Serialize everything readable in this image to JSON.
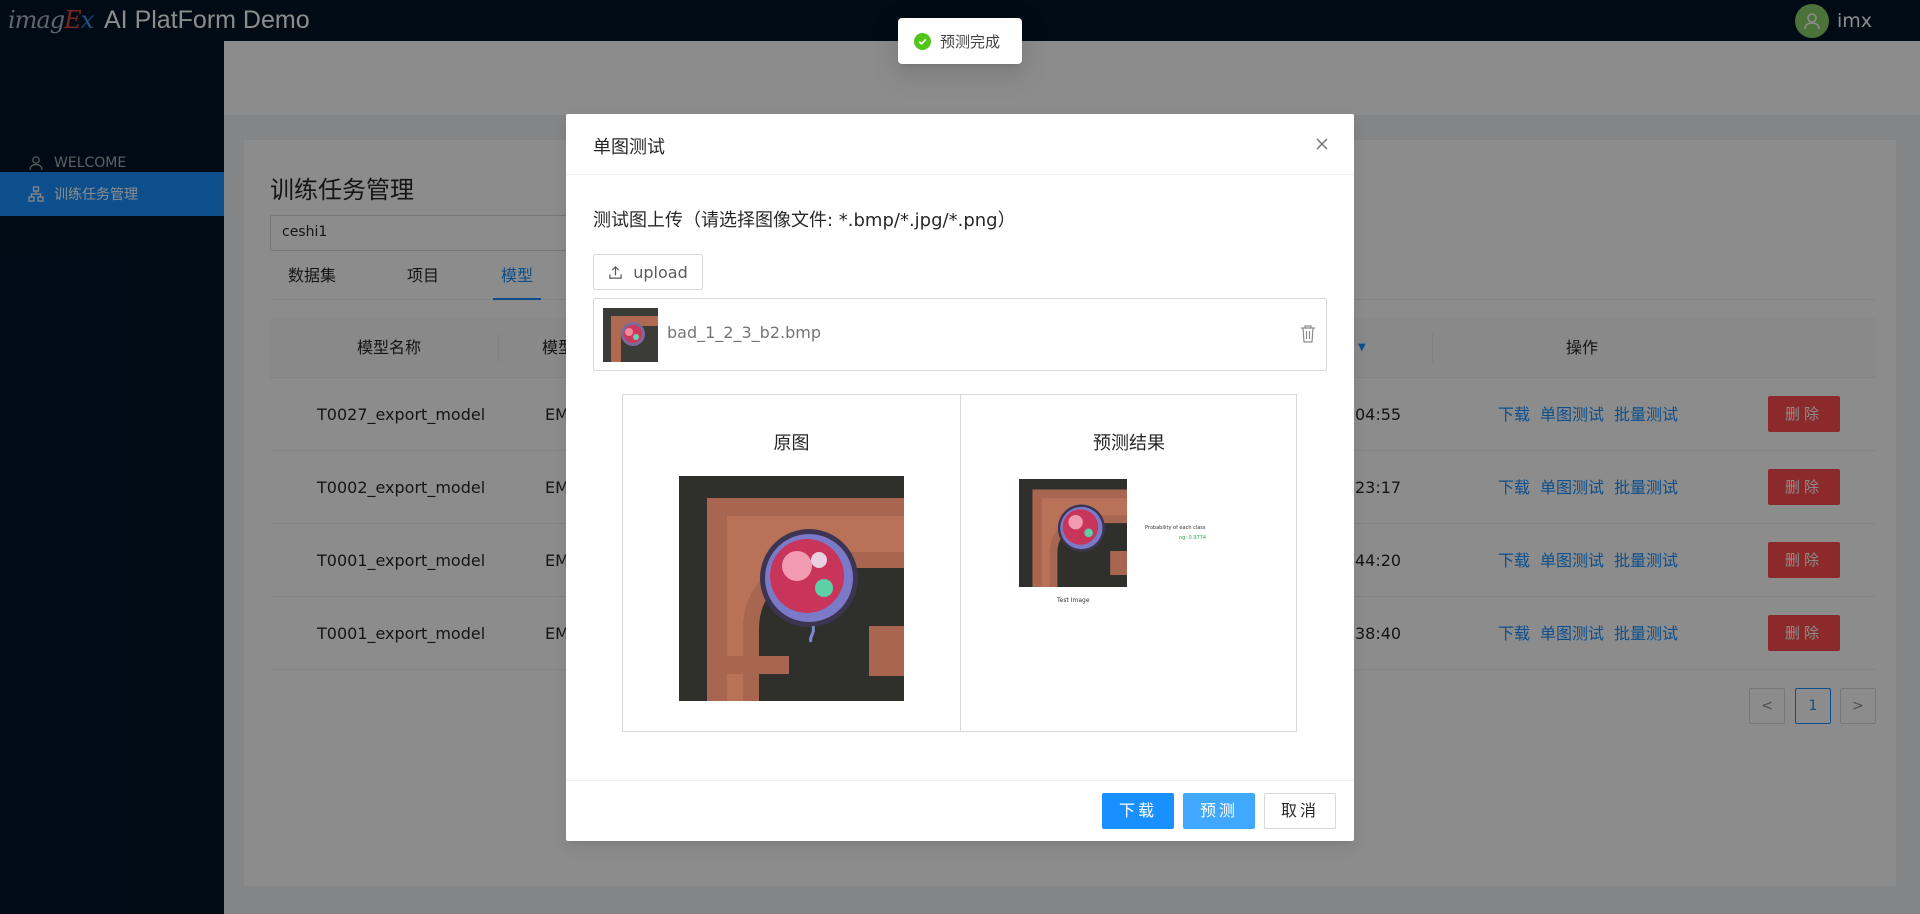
{
  "app": {
    "logo_text": "imagex",
    "title": "AI PlatForm Demo"
  },
  "user": {
    "name": "imx"
  },
  "sidebar": {
    "items": [
      {
        "label": "WELCOME",
        "icon": "user-icon"
      },
      {
        "label": "训练任务管理",
        "icon": "cluster-icon",
        "active": true
      }
    ]
  },
  "page": {
    "title": "训练任务管理",
    "search_value": "ceshi1",
    "tabs": [
      {
        "label": "数据集"
      },
      {
        "label": "项目"
      },
      {
        "label": "模型",
        "active": true
      }
    ]
  },
  "table": {
    "headers": {
      "name": "模型名称",
      "type": "模型",
      "actions": "操作"
    },
    "rows": [
      {
        "name": "T0027_export_model",
        "type": "EM",
        "time": "04:55"
      },
      {
        "name": "T0002_export_model",
        "type": "EM",
        "time": "23:17"
      },
      {
        "name": "T0001_export_model",
        "type": "EM",
        "time": "44:20"
      },
      {
        "name": "T0001_export_model",
        "type": "EM",
        "time": "38:40"
      }
    ],
    "action_labels": {
      "download": "下载",
      "single_test": "单图测试",
      "batch_test": "批量测试",
      "delete": "删除"
    }
  },
  "pagination": {
    "prev": "<",
    "current": "1",
    "next": ">"
  },
  "modal": {
    "title": "单图测试",
    "upload_label": "测试图上传（请选择图像文件: *.bmp/*.jpg/*.png）",
    "upload_button": "upload",
    "file_name": "bad_1_2_3_b2.bmp",
    "original_title": "原图",
    "result_title": "预测结果",
    "result_caption": "Test Image",
    "result_prob_title": "Probability of each class",
    "result_prob_value": "ng: 0.9774",
    "buttons": {
      "download": "下载",
      "predict": "预测",
      "cancel": "取消"
    }
  },
  "message": {
    "text": "预测完成",
    "type": "success"
  },
  "colors": {
    "primary": "#1890ff",
    "danger": "#ff4d4f",
    "sider": "#001529",
    "success": "#52c41a"
  }
}
